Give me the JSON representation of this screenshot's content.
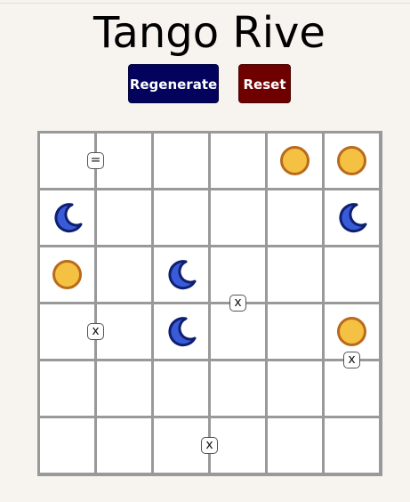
{
  "title": "Tango Rive",
  "buttons": {
    "regenerate": "Regenerate",
    "reset": "Reset"
  },
  "colors": {
    "regenerate_bg": "#03035e",
    "reset_bg": "#6e0000",
    "sun_fill": "#f4c142",
    "sun_border": "#b96a1c",
    "moon_fill": "#3a5bd8",
    "moon_border": "#0f1f70",
    "grid_line": "#999999",
    "background": "#f7f3ef"
  },
  "board": {
    "rows": 6,
    "cols": 6,
    "cells": [
      [
        "",
        "",
        "",
        "",
        "sun",
        "sun"
      ],
      [
        "moon",
        "",
        "",
        "",
        "",
        "moon"
      ],
      [
        "sun",
        "",
        "moon",
        "",
        "",
        ""
      ],
      [
        "",
        "",
        "moon",
        "",
        "",
        "sun"
      ],
      [
        "",
        "",
        "",
        "",
        "",
        ""
      ],
      [
        "",
        "",
        "",
        "",
        "",
        ""
      ]
    ],
    "constraints": [
      {
        "symbol": "=",
        "between": [
          [
            0,
            1
          ],
          [
            0,
            1
          ]
        ],
        "side": "left-edge",
        "row": 0,
        "col": 1
      },
      {
        "symbol": "x",
        "row": 2,
        "col": 3,
        "side": "bottom"
      },
      {
        "symbol": "x",
        "row": 3,
        "col": 1,
        "side": "left-edge"
      },
      {
        "symbol": "x",
        "row": 3,
        "col": 5,
        "side": "bottom"
      },
      {
        "symbol": "x",
        "row": 5,
        "col": 3,
        "side": "left-edge"
      }
    ]
  }
}
